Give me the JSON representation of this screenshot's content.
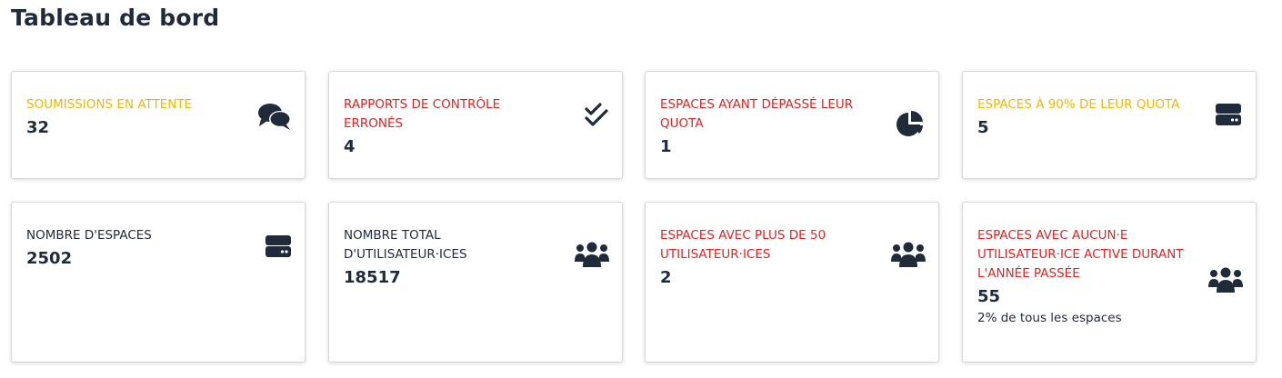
{
  "page": {
    "title": "Tableau de bord"
  },
  "colors": {
    "warning": "#f2b705",
    "danger": "#e02424",
    "text": "#1f2a3a"
  },
  "cards": [
    {
      "label": "SOUMISSIONS EN ATTENTE",
      "value": "32",
      "tone": "warning",
      "icon": "comments-icon"
    },
    {
      "label": "RAPPORTS DE CONTRÔLE ERRONÉS",
      "value": "4",
      "tone": "danger",
      "icon": "double-check-icon"
    },
    {
      "label": "ESPACES AYANT DÉPASSÉ LEUR QUOTA",
      "value": "1",
      "tone": "danger",
      "icon": "pie-chart-icon"
    },
    {
      "label": "ESPACES À 90% DE LEUR QUOTA",
      "value": "5",
      "tone": "warning",
      "icon": "hard-drive-icon"
    },
    {
      "label": "NOMBRE D'ESPACES",
      "value": "2502",
      "tone": "neutral",
      "icon": "hard-drive-icon"
    },
    {
      "label": "NOMBRE TOTAL D'UTILISATEUR·ICES",
      "value": "18517",
      "tone": "neutral",
      "icon": "users-icon"
    },
    {
      "label": "ESPACES AVEC PLUS DE 50 UTILISATEUR·ICES",
      "value": "2",
      "tone": "danger",
      "icon": "users-icon"
    },
    {
      "label": "ESPACES AVEC AUCUN·E UTILISATEUR·ICE ACTIVE DURANT L'ANNÉE PASSÉE",
      "value": "55",
      "tone": "danger",
      "icon": "users-icon",
      "note": "2% de tous les espaces"
    }
  ]
}
